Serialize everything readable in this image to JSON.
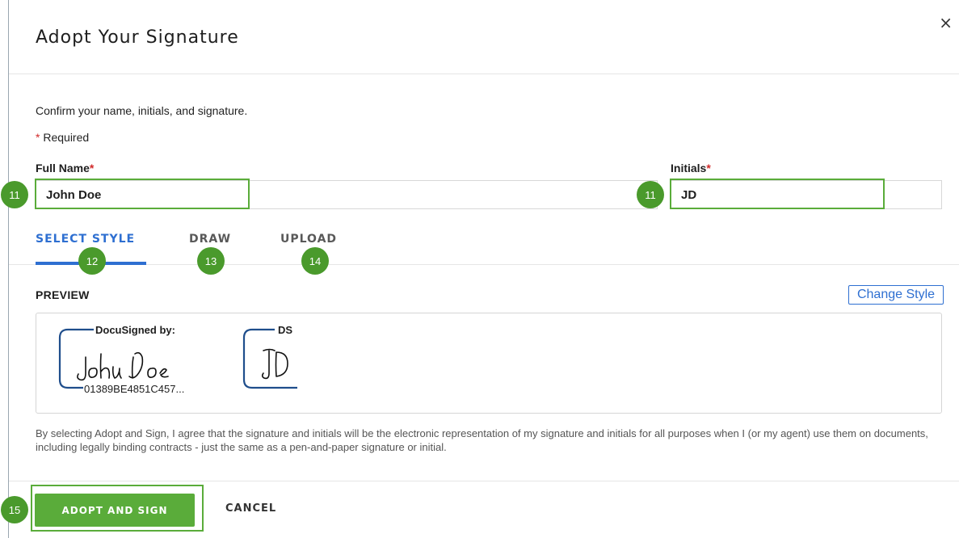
{
  "dialog": {
    "title": "Adopt Your Signature",
    "close_glyph": "×"
  },
  "form": {
    "confirm_text": "Confirm your name, initials, and signature.",
    "required_marker": "*",
    "required_text": "Required",
    "full_name_label": "Full Name",
    "full_name_value": "John Doe",
    "initials_label": "Initials",
    "initials_value": "JD"
  },
  "tabs": [
    {
      "label": "SELECT STYLE",
      "active": true
    },
    {
      "label": "DRAW",
      "active": false
    },
    {
      "label": "UPLOAD",
      "active": false
    }
  ],
  "preview": {
    "label": "PREVIEW",
    "change_style": "Change Style",
    "signature_header": "DocuSigned by:",
    "signature_id": "01389BE4851C457...",
    "initials_header": "DS"
  },
  "disclaimer": "By selecting Adopt and Sign, I agree that the signature and initials will be the electronic representation of my signature and initials for all purposes when I (or my agent) use them on documents, including legally binding contracts - just the same as a pen-and-paper signature or initial.",
  "footer": {
    "adopt_label": "ADOPT AND SIGN",
    "cancel_label": "CANCEL"
  },
  "callouts": {
    "name_field": "11",
    "initials_field": "11",
    "select_style_tab": "12",
    "draw_tab": "13",
    "upload_tab": "14",
    "adopt_button": "15"
  },
  "colors": {
    "accent_blue": "#2e6fd1",
    "adopt_green": "#5aac3a",
    "callout_green": "#4a9a2c",
    "required_red": "#d12a2a",
    "signature_frame": "#1f4e8c"
  }
}
